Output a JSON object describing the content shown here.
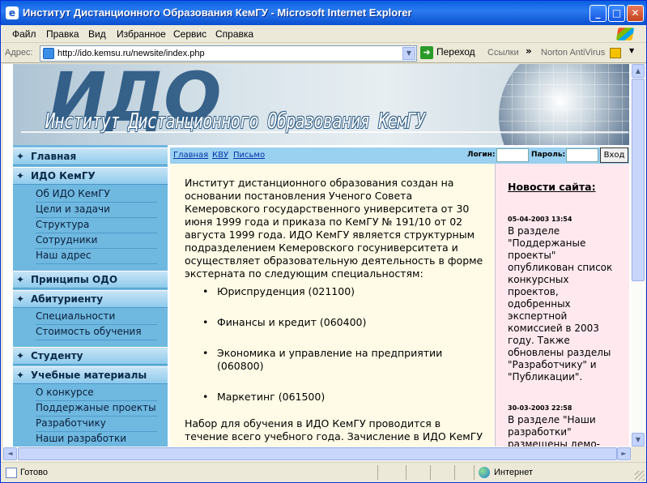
{
  "window": {
    "title": "Институт Дистанционного Образования КемГУ - Microsoft Internet Explorer",
    "app_icon": "e",
    "minimize": "_",
    "maximize": "□",
    "close": "✕"
  },
  "menu": [
    "Файл",
    "Правка",
    "Вид",
    "Избранное",
    "Сервис",
    "Справка"
  ],
  "address": {
    "label": "Адрес:",
    "url": "http://ido.kemsu.ru/newsite/index.php",
    "go": "Переход",
    "links": "Ссылки",
    "chevron": "»",
    "norton": "Norton AntiVirus"
  },
  "banner": {
    "short": "ИДО",
    "full": "Институт Дистанционного Образования КемГУ"
  },
  "nav": {
    "star": "✦",
    "main": "Главная",
    "ido": "ИДО КемГУ",
    "ido_items": [
      "Об ИДО КемГУ",
      "Цели и задачи",
      "Структура",
      "Сотрудники",
      "Наш адрес"
    ],
    "principles": "Принципы ОДО",
    "applicant": "Абитуриенту",
    "applicant_items": [
      "Специальности",
      "Стоимость обучения"
    ],
    "student": "Студенту",
    "materials": "Учебные материалы",
    "material_items": [
      "О конкурсе",
      "Поддержаные проекты",
      "Разработчику",
      "Наши разработки"
    ]
  },
  "topbar": {
    "links": [
      "Главная",
      "КВУ",
      "Письмо"
    ],
    "login_label": "Логин:",
    "password_label": "Пароль:",
    "login_button": "Вход"
  },
  "main": {
    "intro": "Институт дистанционного образования создан на основании постановления Ученого Совета Кемеровского государственного университета от 30 июня 1999 года и приказа по КемГУ № 191/10 от 02 августа 1999 года. ИДО КемГУ является структурным подразделением Кемеровского госуниверситета и осуществляет образовательную деятельность в форме экстерната по следующим специальностям:",
    "specialties": [
      "Юриспруденция (021100)",
      "Финансы и кредит (060400)",
      "Экономика и управление на предприятии (060800)",
      "Маркетинг (061500)"
    ],
    "outro": "Набор для обучения в ИДО КемГУ проводится в течение всего учебного года. Зачисление в ИДО КемГУ производится на основе проведения вступительных"
  },
  "news": {
    "title": "Новости сайта:",
    "items": [
      {
        "date": "05-04-2003 13:54",
        "text": "В разделе \"Поддержаные проекты\" опубликован список конкурсных проектов, одобренных экспертной комиссией в 2003 году. Также обновлены разделы \"Разработчику\" и \"Публикации\"."
      },
      {
        "date": "30-03-2003 22:58",
        "text": "В разделе \"Наши разработки\" размещены демо-"
      }
    ]
  },
  "status": {
    "text": "Готово",
    "zone": "Интернет"
  },
  "scroll": {
    "up": "▲",
    "down": "▼",
    "left": "◄",
    "right": "►"
  }
}
